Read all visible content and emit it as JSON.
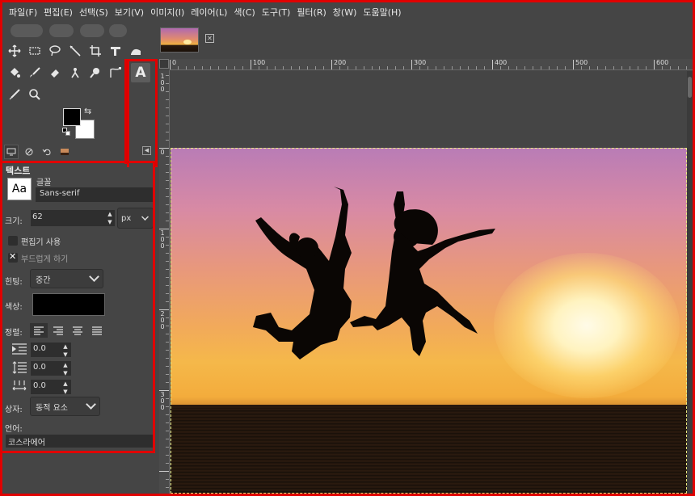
{
  "menubar": {
    "items": [
      "파일(F)",
      "편집(E)",
      "선택(S)",
      "보기(V)",
      "이미지(I)",
      "레이어(L)",
      "색(C)",
      "도구(T)",
      "필터(R)",
      "창(W)",
      "도움말(H)"
    ]
  },
  "toolbox": {
    "text_tool_glyph": "A",
    "foreground_color": "#000000",
    "background_color": "#ffffff"
  },
  "tool_options": {
    "title": "텍스트",
    "font_preview": "Aa",
    "font_label": "글꼴",
    "font_value": "Sans-serif",
    "size_label": "크기:",
    "size_value": "62",
    "unit_value": "px",
    "use_editor_label": "편집기 사용",
    "antialias_label": "부드럽게 하기",
    "hinting_label": "힌팅:",
    "hinting_value": "중간",
    "color_label": "색상:",
    "color_value": "#000000",
    "justify_label": "정렬:",
    "indent_value": "0.0",
    "line_spacing_value": "0.0",
    "letter_spacing_value": "0.0",
    "box_label": "상자:",
    "box_value": "동적 요소",
    "language_label": "언어:",
    "language_value": "코스라에어"
  },
  "ruler": {
    "h_labels": [
      "0",
      "100",
      "200",
      "300",
      "400",
      "500",
      "600"
    ],
    "v_labels": [
      "0",
      "100",
      "200",
      "300"
    ]
  }
}
